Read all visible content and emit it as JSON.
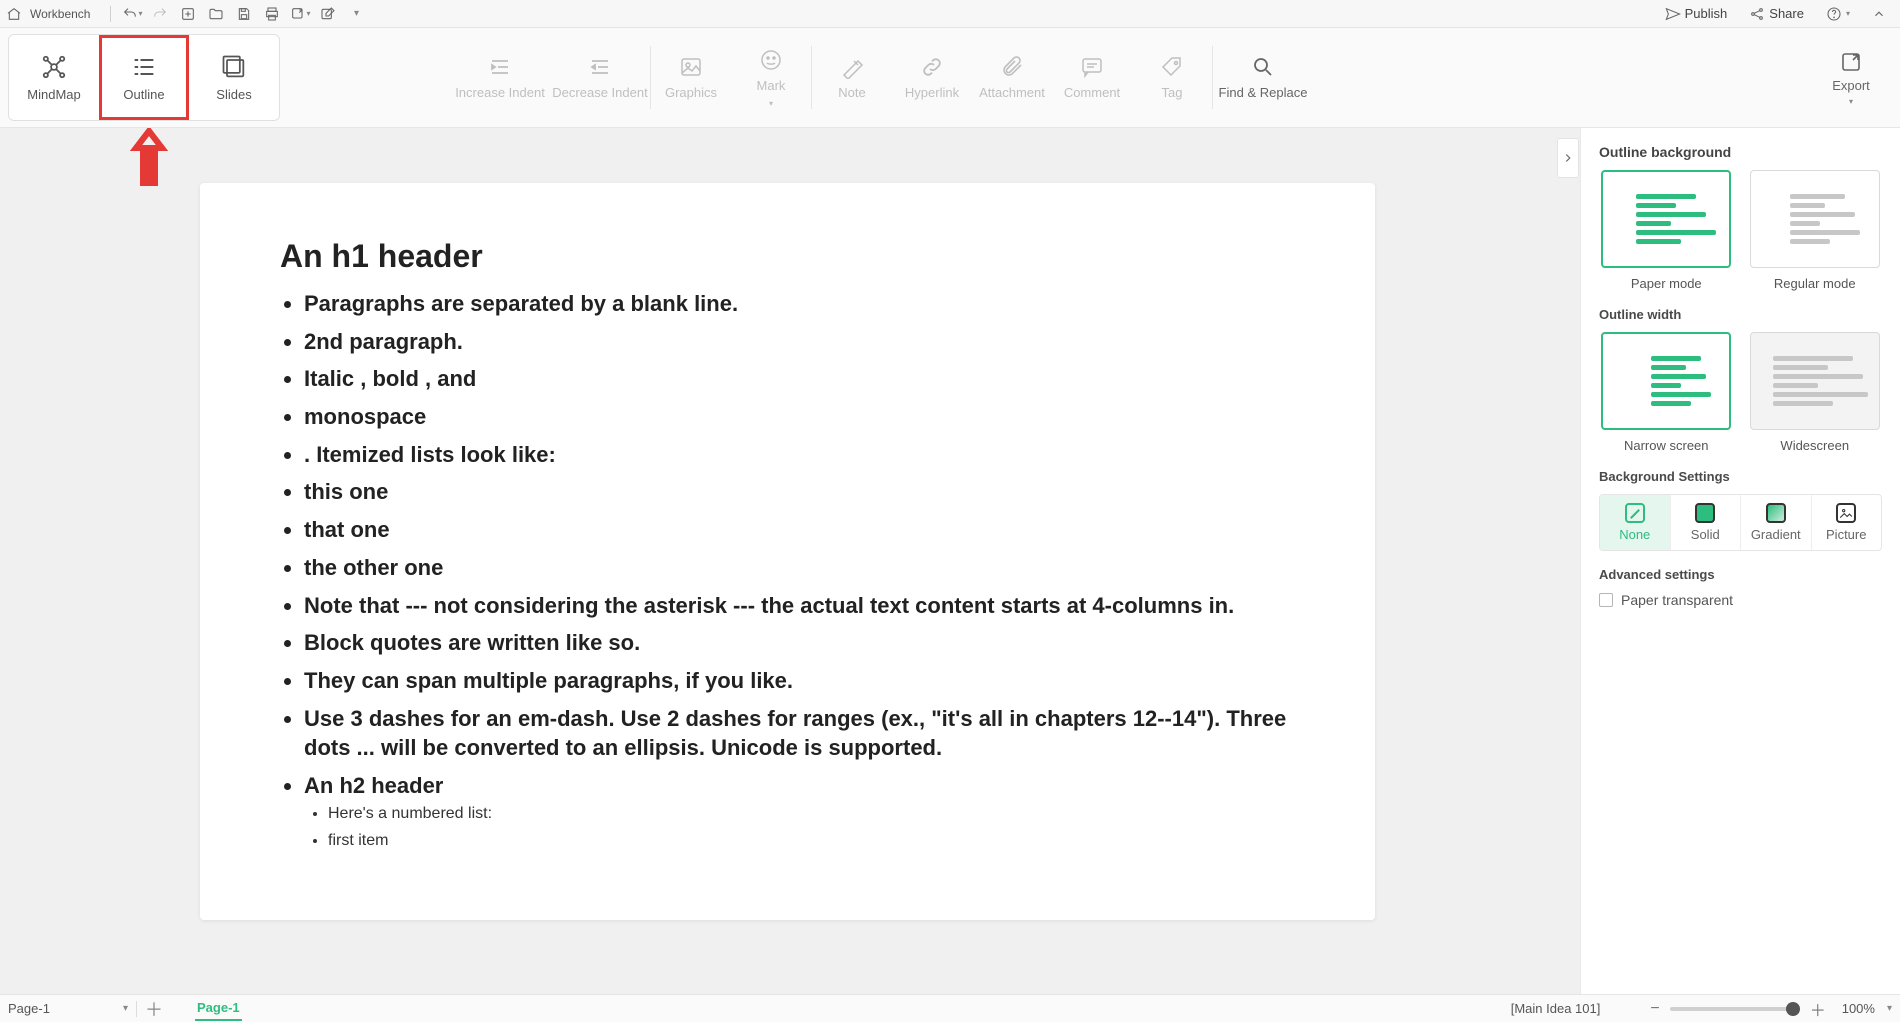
{
  "titlebar": {
    "workbench": "Workbench",
    "publish": "Publish",
    "share": "Share"
  },
  "views": {
    "mindmap": "MindMap",
    "outline": "Outline",
    "slides": "Slides"
  },
  "toolbar": {
    "increase_indent": "Increase Indent",
    "decrease_indent": "Decrease Indent",
    "graphics": "Graphics",
    "mark": "Mark",
    "note": "Note",
    "hyperlink": "Hyperlink",
    "attachment": "Attachment",
    "comment": "Comment",
    "tag": "Tag",
    "find_replace": "Find & Replace",
    "export": "Export"
  },
  "document": {
    "title": "An h1 header",
    "items": [
      "Paragraphs are separated by a blank line.",
      "2nd paragraph.",
      "Italic , bold , and",
      "monospace",
      ". Itemized lists look like:",
      "this one",
      "that one",
      "the other one",
      "Note that --- not considering the asterisk --- the actual text content starts at 4-columns in.",
      "Block quotes are written like so.",
      "They can span multiple paragraphs, if you like.",
      "Use 3 dashes for an em-dash. Use 2 dashes for ranges (ex., \"it's all in chapters 12--14\"). Three dots ... will be converted to an ellipsis. Unicode is supported.",
      "An h2 header"
    ],
    "sub_items": [
      "Here's a numbered list:",
      "first item"
    ]
  },
  "panel": {
    "outline_background": "Outline background",
    "paper_mode": "Paper mode",
    "regular_mode": "Regular mode",
    "outline_width": "Outline width",
    "narrow": "Narrow screen",
    "wide": "Widescreen",
    "bg_settings": "Background Settings",
    "bg_none": "None",
    "bg_solid": "Solid",
    "bg_gradient": "Gradient",
    "bg_picture": "Picture",
    "advanced": "Advanced settings",
    "paper_transparent": "Paper transparent"
  },
  "statusbar": {
    "page_select": "Page-1",
    "tab": "Page-1",
    "main_idea": "[Main Idea 101]",
    "zoom": "100%"
  }
}
